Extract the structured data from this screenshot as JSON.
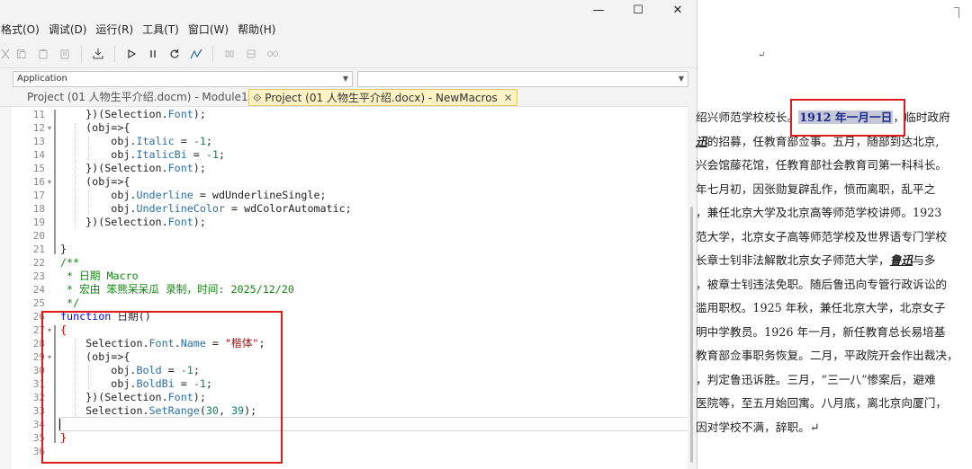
{
  "window_controls": {
    "minimize": "—",
    "maximize": "☐",
    "close": "✕"
  },
  "menu": [
    "格式(O)",
    "调试(D)",
    "运行(R)",
    "工具(T)",
    "窗口(W)",
    "帮助(H)"
  ],
  "combos": {
    "left": "Application",
    "right": ""
  },
  "tabs": [
    {
      "label": "Project (01 人物生平介绍.docm) - Module1",
      "active": false
    },
    {
      "label": "Project (01 人物生平介绍.docx) - NewMacros",
      "active": true
    }
  ],
  "code_lines": [
    {
      "n": "11",
      "text": "    })(Selection.Font);"
    },
    {
      "n": "12",
      "text": "    (obj=>{"
    },
    {
      "n": "13",
      "text": "        obj.Italic = -1;"
    },
    {
      "n": "14",
      "text": "        obj.ItalicBi = -1;"
    },
    {
      "n": "15",
      "text": "    })(Selection.Font);"
    },
    {
      "n": "16",
      "text": "    (obj=>{"
    },
    {
      "n": "17",
      "text": "        obj.Underline = wdUnderlineSingle;"
    },
    {
      "n": "18",
      "text": "        obj.UnderlineColor = wdColorAutomatic;"
    },
    {
      "n": "19",
      "text": "    })(Selection.Font);"
    },
    {
      "n": "20",
      "text": ""
    },
    {
      "n": "21",
      "text": "}"
    },
    {
      "n": "22",
      "text": "/**"
    },
    {
      "n": "23",
      "text": " * 日期 Macro"
    },
    {
      "n": "24",
      "text": " * 宏由 笨熊呆呆瓜 录制，时间: 2025/12/20"
    },
    {
      "n": "25",
      "text": " */"
    },
    {
      "n": "26",
      "text": "function 日期()"
    },
    {
      "n": "27",
      "text": "{"
    },
    {
      "n": "28",
      "text": "    Selection.Font.Name = \"楷体\";"
    },
    {
      "n": "29",
      "text": "    (obj=>{"
    },
    {
      "n": "30",
      "text": "        obj.Bold = -1;"
    },
    {
      "n": "31",
      "text": "        obj.BoldBi = -1;"
    },
    {
      "n": "32",
      "text": "    })(Selection.Font);"
    },
    {
      "n": "33",
      "text": "    Selection.SetRange(30, 39);"
    },
    {
      "n": "34",
      "text": ""
    },
    {
      "n": "35",
      "text": "}"
    },
    {
      "n": "36",
      "text": ""
    }
  ],
  "doc": {
    "top_mark": "↵",
    "lines": [
      {
        "pre": "绍兴师范学校校长。",
        "hl": "1912 年一月一日",
        "post": "，临时政府"
      },
      {
        "pre": "",
        "bu": "迅",
        "post": "的招募，任教育部佥事。五月，随部到达北京,"
      },
      {
        "pre": "兴会馆藤花馆，任教育部社会教育司第一科科长。"
      },
      {
        "pre": "年七月初，因张勋复辟乱作，愤而离职，乱平之"
      },
      {
        "pre": "，兼任北京大学及北京高等师范学校讲师。1923"
      },
      {
        "pre": "范大学，北京女子高等师范学校及世界语专门学校"
      },
      {
        "pre": "长章士钊非法解散北京女子师范大学，",
        "bu": "鲁迅",
        "post": "与多"
      },
      {
        "pre": "，被章士钊违法免职。随后鲁迅向专管行政诉讼的"
      },
      {
        "pre": "滥用职权。1925 年秋，兼任北京大学，北京女子"
      },
      {
        "pre": "明中学教员。1926 年一月，新任教育总长易培基"
      },
      {
        "pre": "教育部佥事职务恢复。二月，平政院开会作出裁决，"
      },
      {
        "pre": "，判定鲁迅诉胜。三月，“三一八”惨案后，避难"
      },
      {
        "pre": "医院等，至五月始回寓。八月底，离北京向厦门，"
      },
      {
        "pre": "因对学校不满，辞职。↵"
      }
    ]
  },
  "colors": {
    "keyword": "#0000ff",
    "property": "#2b6fa6",
    "number": "#098658",
    "string": "#a31515",
    "comment": "#0f8a0f",
    "brace_error": "#d60000",
    "annotation_box": "#e01b1b",
    "doc_highlight": "#c5c8d6"
  }
}
